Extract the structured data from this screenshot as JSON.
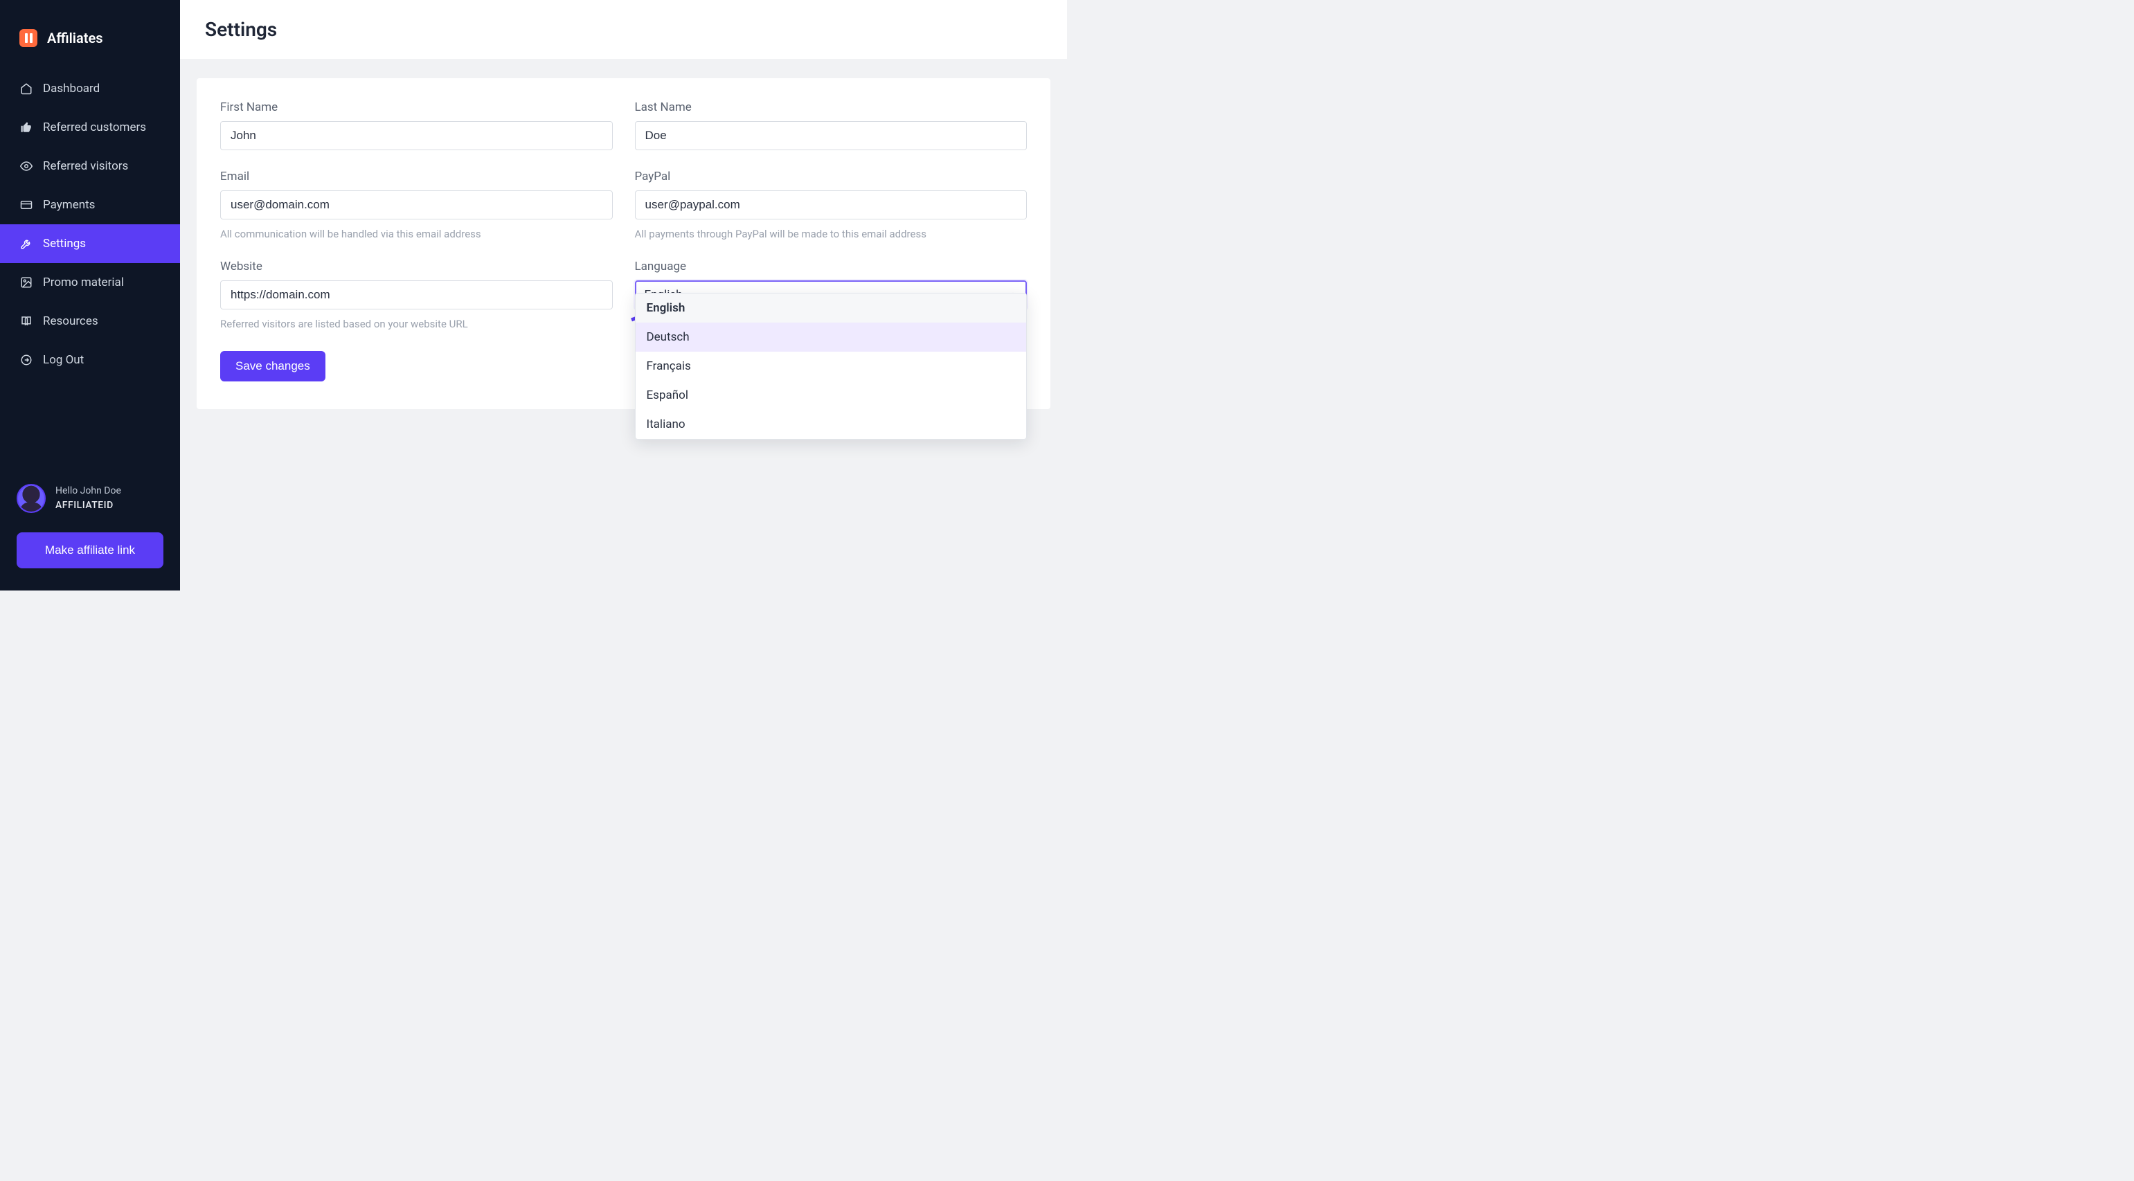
{
  "brand": {
    "title": "Affiliates"
  },
  "sidebar": {
    "items": [
      {
        "label": "Dashboard",
        "icon": "home-icon"
      },
      {
        "label": "Referred customers",
        "icon": "thumbs-up-icon"
      },
      {
        "label": "Referred visitors",
        "icon": "eye-icon"
      },
      {
        "label": "Payments",
        "icon": "credit-card-icon"
      },
      {
        "label": "Settings",
        "icon": "wrench-icon",
        "active": true
      },
      {
        "label": "Promo material",
        "icon": "image-icon"
      },
      {
        "label": "Resources",
        "icon": "book-icon"
      },
      {
        "label": "Log Out",
        "icon": "logout-icon"
      }
    ],
    "user": {
      "greeting": "Hello John Doe",
      "affiliate_id": "AFFILIATEID"
    },
    "make_link_label": "Make affiliate link"
  },
  "page": {
    "title": "Settings"
  },
  "form": {
    "first_name": {
      "label": "First Name",
      "value": "John"
    },
    "last_name": {
      "label": "Last Name",
      "value": "Doe"
    },
    "email": {
      "label": "Email",
      "value": "user@domain.com",
      "help": "All communication will be handled via this email address"
    },
    "paypal": {
      "label": "PayPal",
      "value": "user@paypal.com",
      "help": "All payments through PayPal will be made to this email address"
    },
    "website": {
      "label": "Website",
      "value": "https://domain.com",
      "help": "Referred visitors are listed based on your website URL"
    },
    "language": {
      "label": "Language",
      "selected": "English",
      "options": [
        "English",
        "Deutsch",
        "Français",
        "Español",
        "Italiano"
      ]
    },
    "save_label": "Save changes"
  }
}
